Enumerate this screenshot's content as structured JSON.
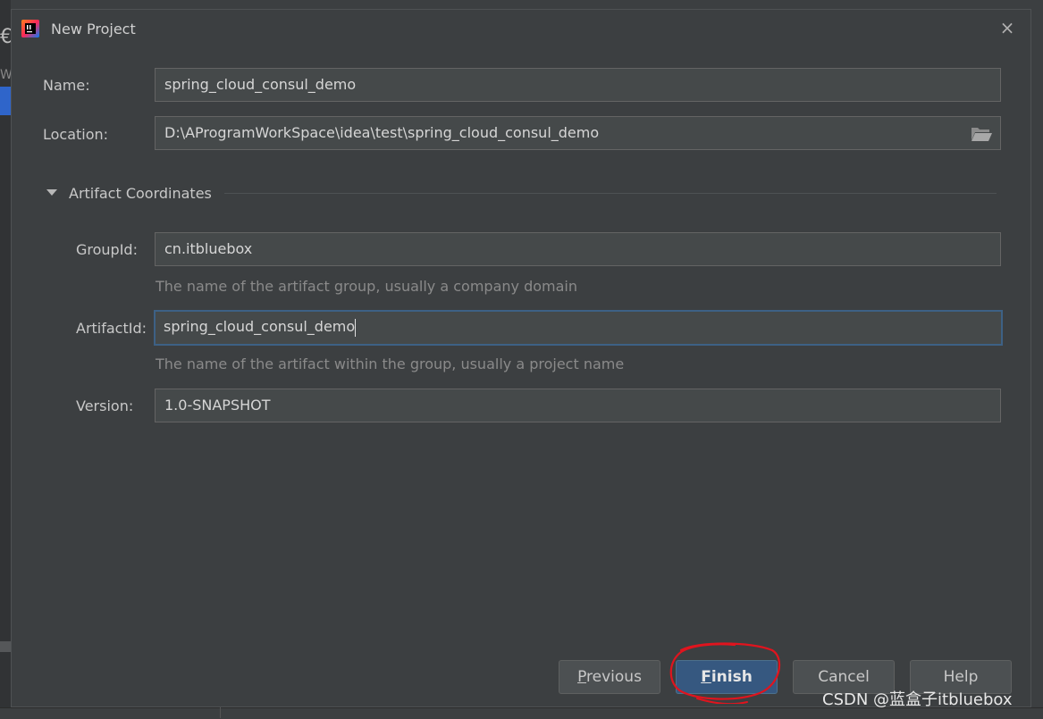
{
  "window": {
    "title": "New Project",
    "close_glyph": "×"
  },
  "form": {
    "name": {
      "label": "Name:",
      "value": "spring_cloud_consul_demo"
    },
    "location": {
      "label": "Location:",
      "value": "D:\\AProgramWorkSpace\\idea\\test\\spring_cloud_consul_demo"
    }
  },
  "artifact": {
    "section_title": "Artifact Coordinates",
    "expanded": true,
    "group_id": {
      "label": "GroupId:",
      "value": "cn.itbluebox",
      "hint": "The name of the artifact group, usually a company domain"
    },
    "artifact_id": {
      "label": "ArtifactId:",
      "value": "spring_cloud_consul_demo",
      "hint": "The name of the artifact within the group, usually a project name"
    },
    "version": {
      "label": "Version:",
      "value": "1.0-SNAPSHOT"
    }
  },
  "buttons": {
    "previous": {
      "mnemonic": "P",
      "rest": "revious"
    },
    "finish": {
      "mnemonic": "F",
      "rest": "inish"
    },
    "cancel": {
      "label": "Cancel"
    },
    "help": {
      "label": "Help"
    }
  },
  "watermark": "CSDN @蓝盒子itbluebox",
  "background": {
    "glyph_top": "€",
    "glyph_w": "W"
  },
  "colors": {
    "dialog_bg": "#3c3f41",
    "field_bg": "#45494a",
    "primary_button": "#365880",
    "annotation_red": "#e0141e",
    "focus_border": "#3d6185"
  }
}
